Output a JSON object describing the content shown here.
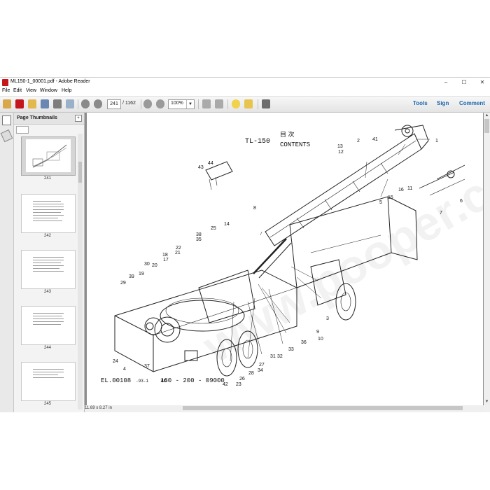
{
  "window": {
    "title": "ML150-1_00001.pdf - Adobe Reader",
    "controls": {
      "minimize": "–",
      "maximize": "☐",
      "close": "✕"
    }
  },
  "menu": [
    "File",
    "Edit",
    "View",
    "Window",
    "Help"
  ],
  "toolbar": {
    "current_page": "241",
    "total_pages": "/ 1162",
    "zoom": "100%",
    "tools_label": "Tools",
    "sign_label": "Sign",
    "comment_label": "Comment"
  },
  "thumbnails": {
    "title": "Page Thumbnails",
    "pages": [
      "241",
      "242",
      "243",
      "244",
      "245"
    ],
    "selected": "241"
  },
  "status": {
    "page_size": "11.69 x 8.27 in"
  },
  "document": {
    "model": "TL-150",
    "title_cjk": "目  次",
    "title_en": "CONTENTS",
    "code_left": "EL.00108",
    "code_left_suffix": "-93-1",
    "code_right": "160 - 200 - 09000",
    "callouts": [
      "1",
      "2",
      "3",
      "4",
      "5",
      "6",
      "7",
      "8",
      "9",
      "10",
      "11",
      "12",
      "13",
      "14",
      "15",
      "16",
      "17",
      "18",
      "19",
      "20",
      "21",
      "22",
      "23",
      "24",
      "25",
      "26",
      "27",
      "28",
      "29",
      "30",
      "31",
      "32",
      "33",
      "34",
      "35",
      "36",
      "37",
      "38",
      "39",
      "40",
      "41",
      "42",
      "43",
      "44"
    ]
  },
  "colors": {
    "accent": "#1a67ad",
    "pdf_red": "#c4161c"
  }
}
